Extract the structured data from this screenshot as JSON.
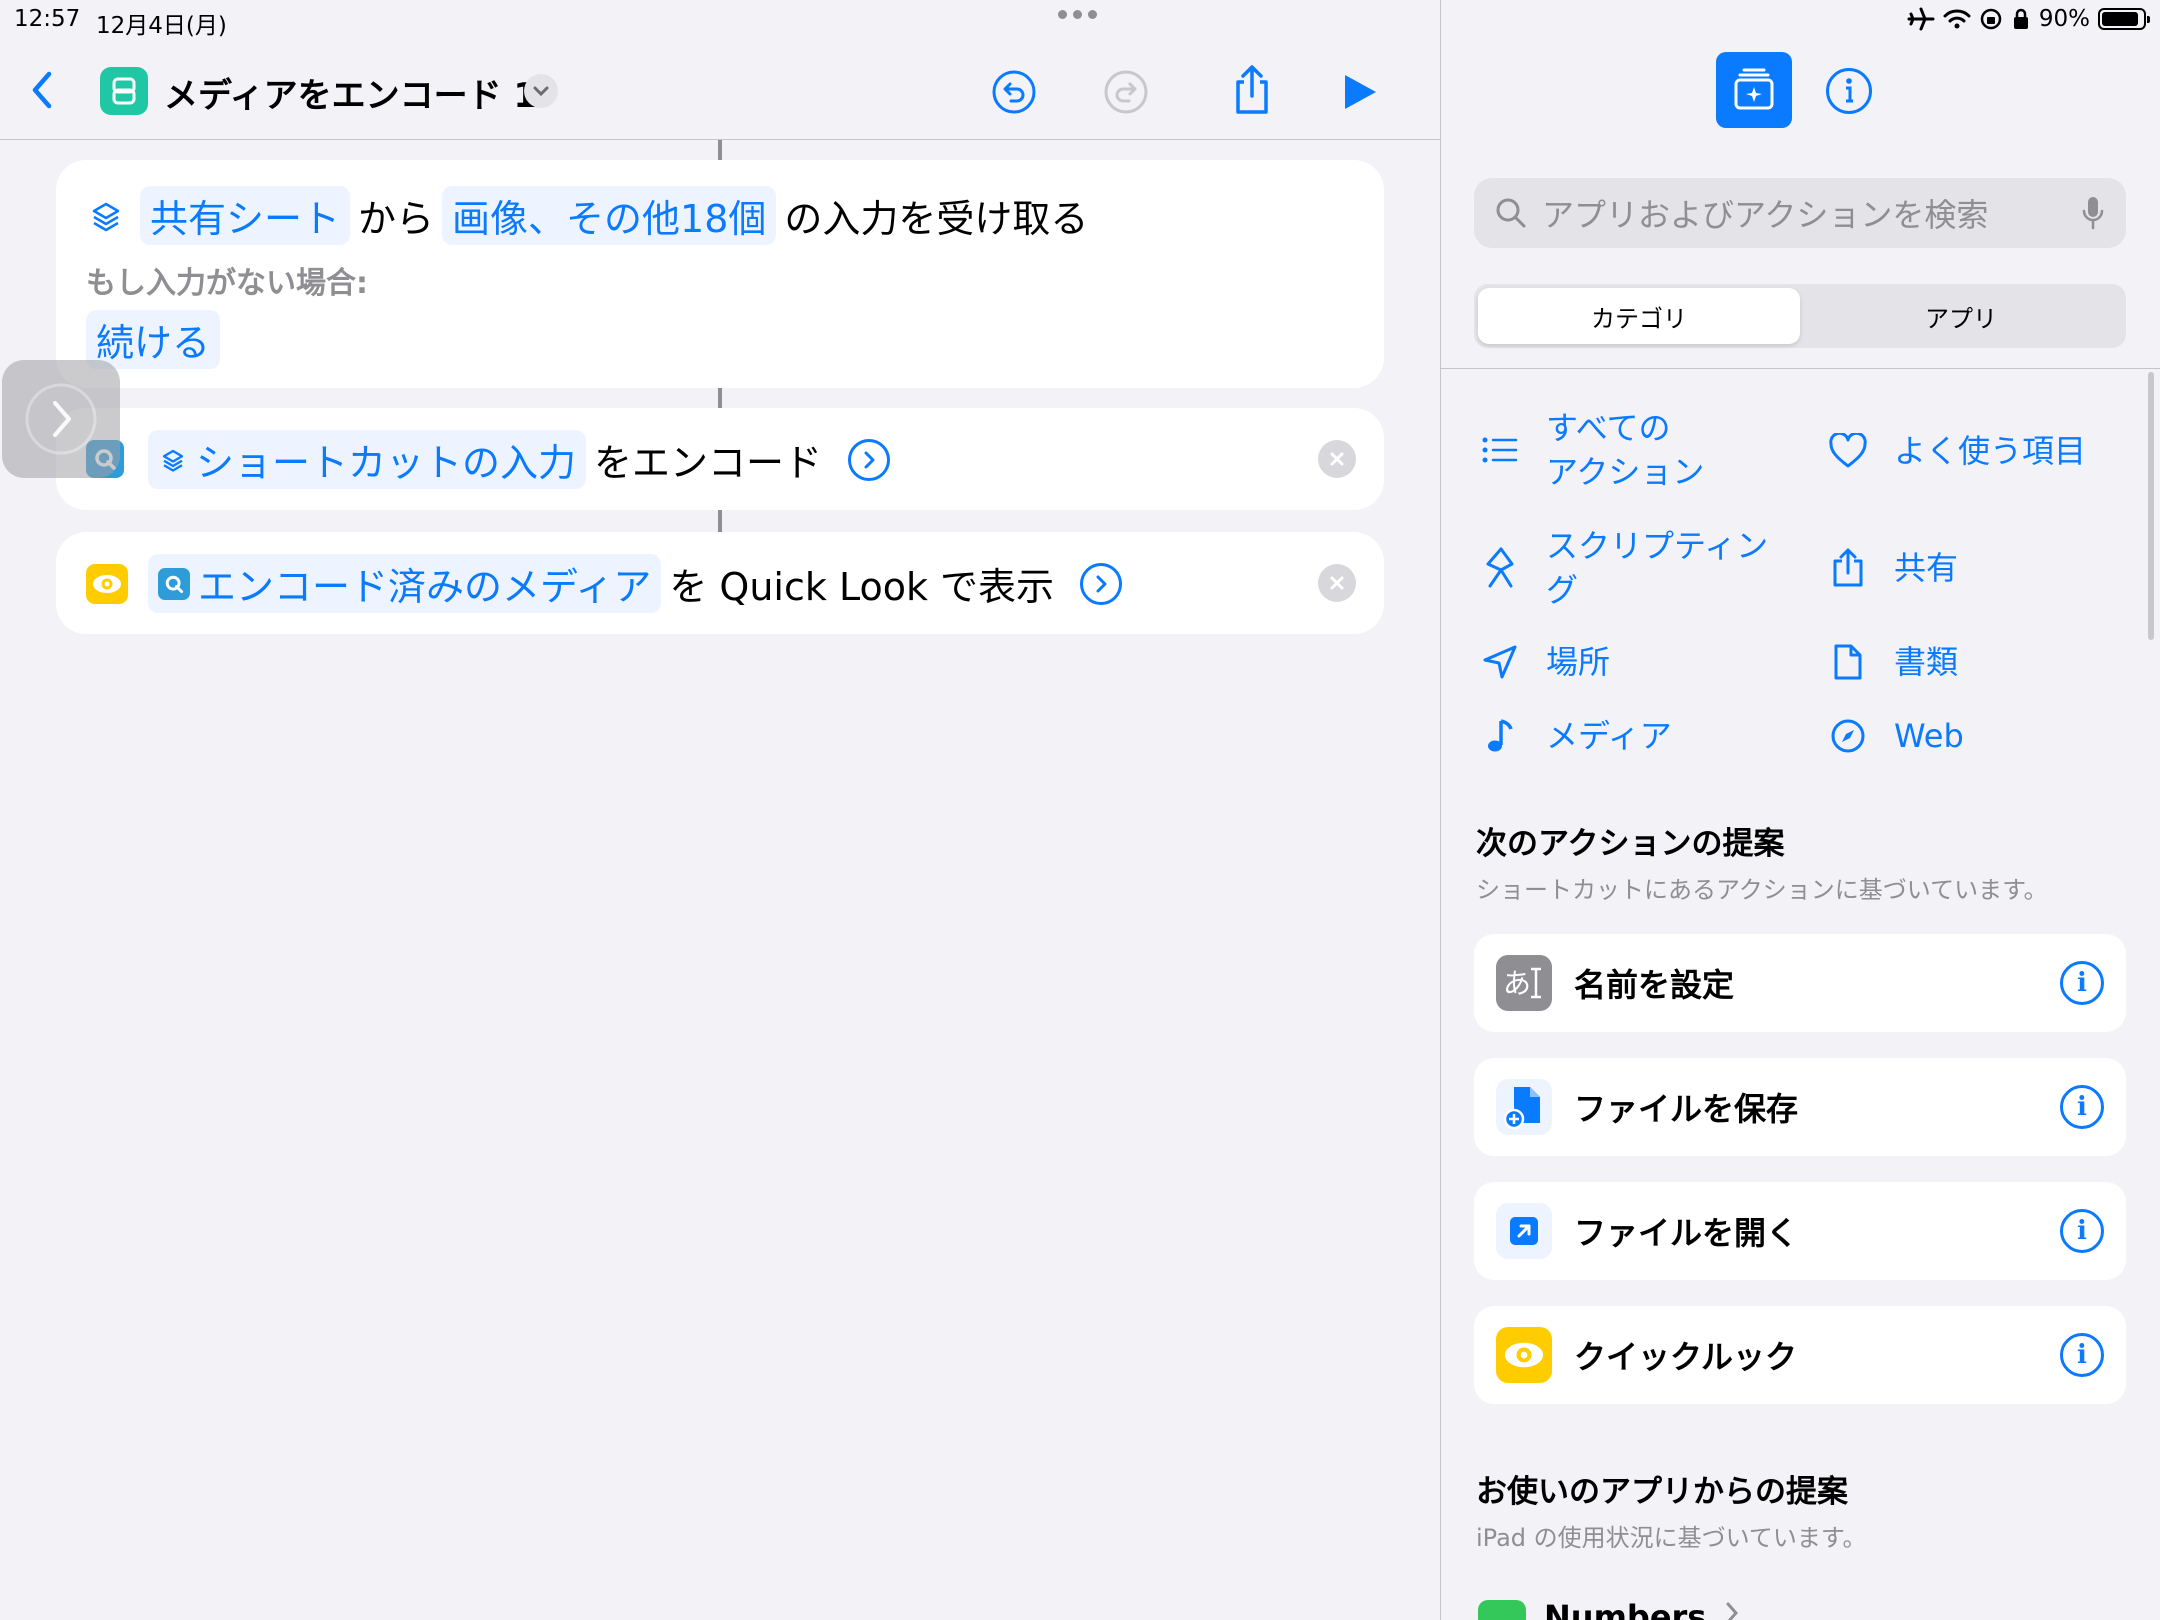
{
  "status": {
    "time": "12:57",
    "date": "12月4日(月)",
    "battery": "90%",
    "battery_level": 0.9
  },
  "toolbar": {
    "title": "メディアをエンコード 1"
  },
  "actions": {
    "receive": {
      "source": "共有シート",
      "from": "から",
      "types": "画像、その他18個",
      "suffix": "の入力を受け取る",
      "if_none_label": "もし入力がない場合:",
      "if_none_value": "続ける"
    },
    "encode": {
      "input": "ショートカットの入力",
      "suffix": "をエンコード"
    },
    "quicklook": {
      "input": "エンコード済みのメディア",
      "suffix": "を Quick Look で表示"
    }
  },
  "panel": {
    "search_placeholder": "アプリおよびアクションを検索",
    "segments": [
      "カテゴリ",
      "アプリ"
    ],
    "categories": {
      "all_line1": "すべての",
      "all_line2": "アクション",
      "favorites": "よく使う項目",
      "scripting_line1": "スクリプティン",
      "scripting_line2": "グ",
      "share": "共有",
      "location": "場所",
      "documents": "書類",
      "media": "メディア",
      "web": "Web"
    },
    "next_actions_title": "次のアクションの提案",
    "next_actions_sub": "ショートカットにあるアクションに基づいています。",
    "suggestions": [
      "名前を設定",
      "ファイルを保存",
      "ファイルを開く",
      "クイックルック"
    ],
    "app_suggest_title": "お使いのアプリからの提案",
    "app_suggest_sub": "iPad の使用状況に基づいています。",
    "app_peek": "Numbers"
  },
  "colors": {
    "accent": "#0a7aff",
    "shortcut_app": "#1fc7a5",
    "quicklook": "#ffcc00"
  }
}
